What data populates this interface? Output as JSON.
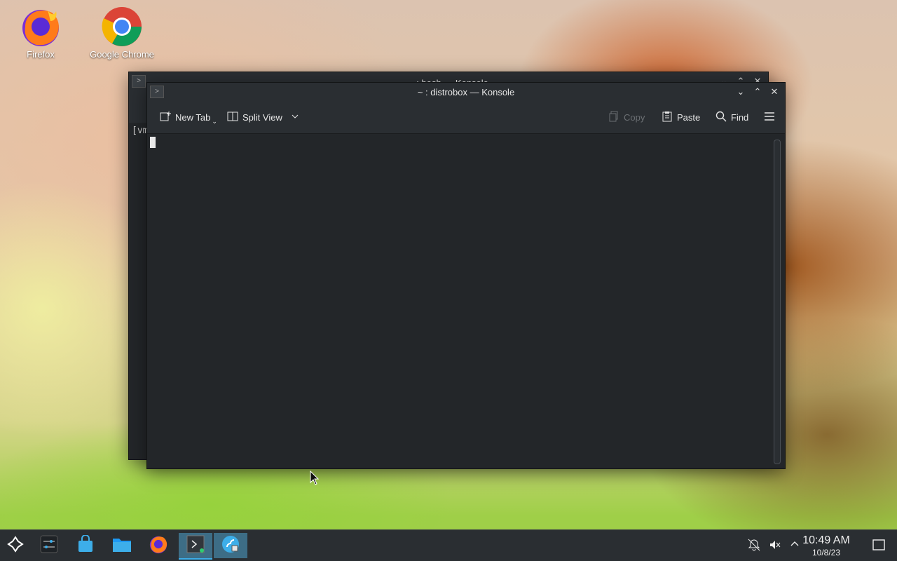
{
  "desktop": {
    "icons": [
      {
        "label": "Firefox"
      },
      {
        "label": "Google Chrome"
      }
    ]
  },
  "back_window": {
    "title": "~ : bash — Konsole",
    "terminal_text": "[vm"
  },
  "front_window": {
    "title": "~ : distrobox — Konsole",
    "toolbar": {
      "new_tab": "New Tab",
      "split_view": "Split View",
      "copy": "Copy",
      "paste": "Paste",
      "find": "Find"
    }
  },
  "taskbar": {
    "clock_time": "10:49 AM",
    "clock_date": "10/8/23"
  },
  "colors": {
    "panel": "#2a2e32",
    "terminal_bg": "#232629",
    "accent": "#3daee9"
  }
}
